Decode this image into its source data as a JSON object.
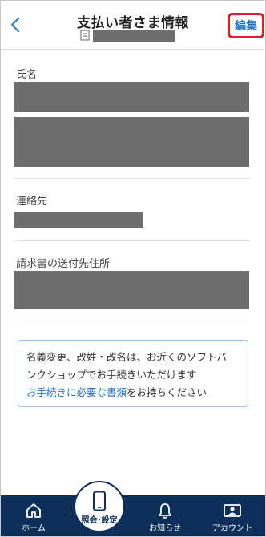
{
  "header": {
    "title": "支払い者さま情報",
    "edit_label": "編集"
  },
  "fields": [
    {
      "label": "氏名"
    },
    {
      "label": "連絡先"
    },
    {
      "label": "請求書の送付先住所"
    }
  ],
  "notice": {
    "line1": "名義変更、改姓・改名は、お近くのソフトバ",
    "line2": "ンクショップでお手続きいただけます",
    "link_text": "お手続きに必要な書類",
    "link_suffix": "をお持ちください"
  },
  "tabbar": {
    "tabs": [
      {
        "label": "ホーム",
        "icon": "home-icon"
      },
      {
        "label": "照会･設定",
        "icon": "smartphone-icon"
      },
      {
        "label": "お知らせ",
        "icon": "bell-icon"
      },
      {
        "label": "アカウント",
        "icon": "account-card-icon"
      }
    ]
  },
  "colors": {
    "accent": "#1f6fc7",
    "tabbar": "#0e2f5a",
    "highlight": "#e02020"
  }
}
